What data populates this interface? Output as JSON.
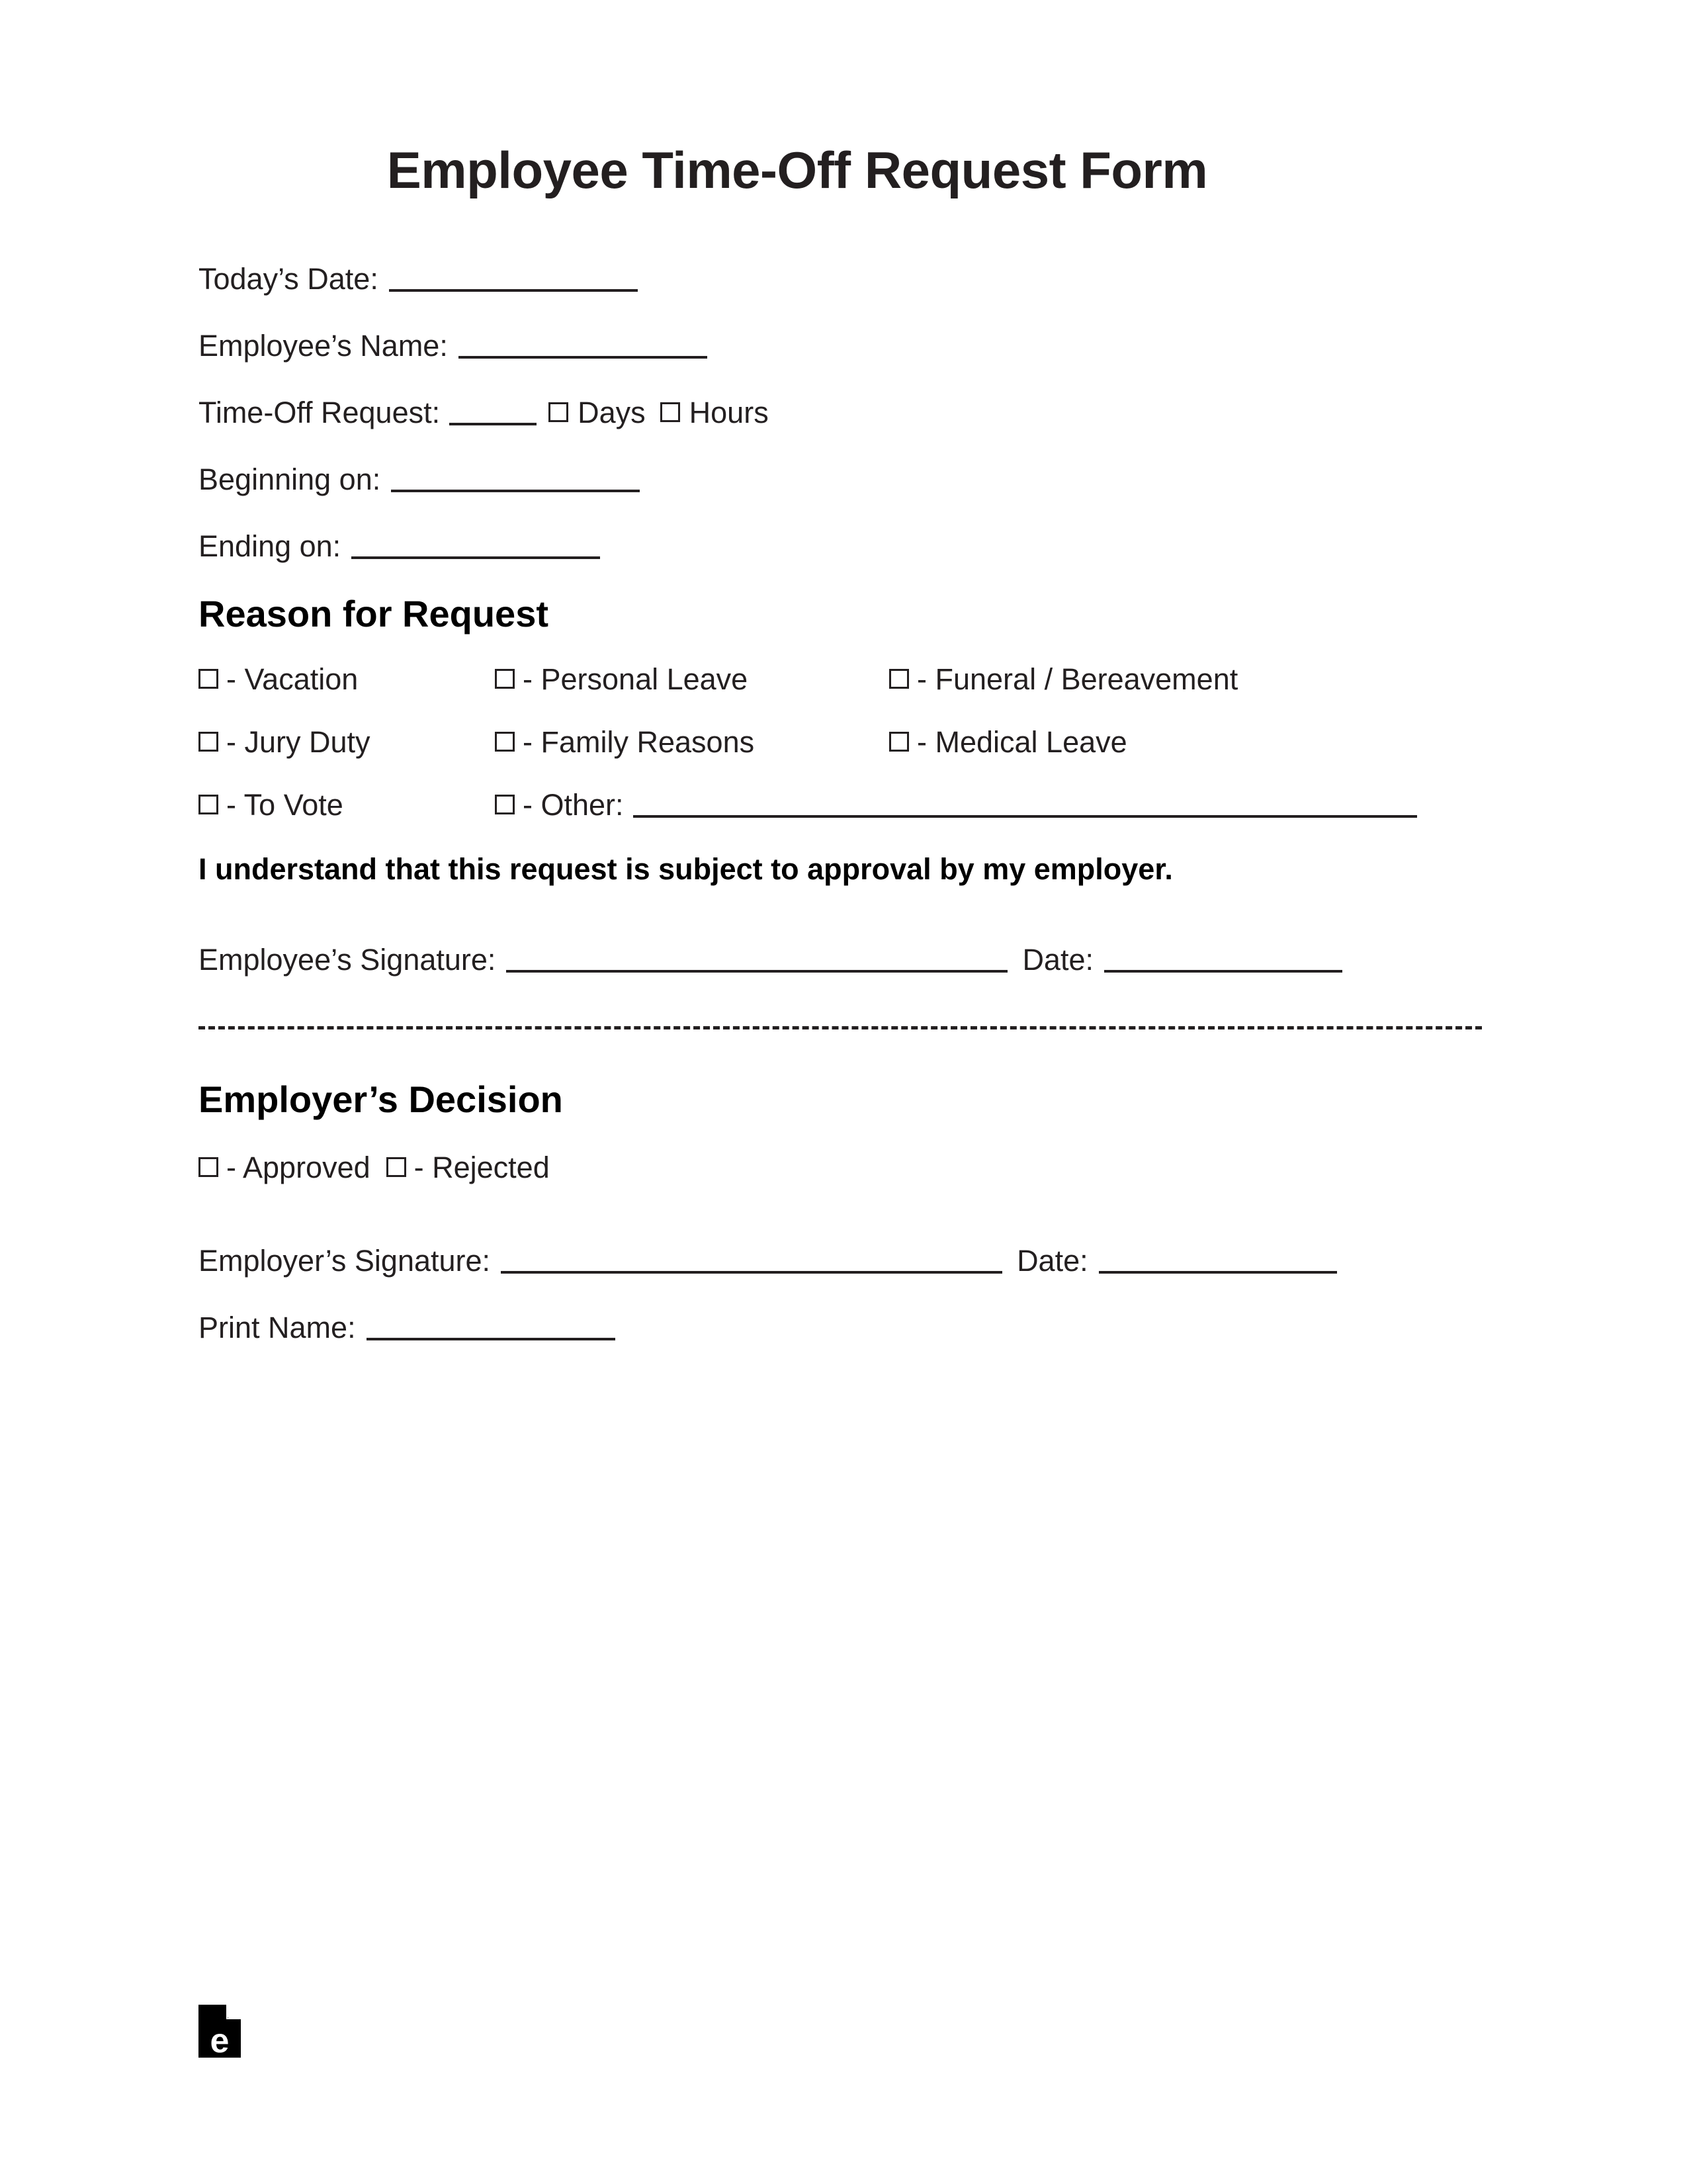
{
  "document": {
    "title": "Employee Time-Off Request Form"
  },
  "fields": {
    "todays_date_label": "Today’s Date:",
    "employee_name_label": "Employee’s Name:",
    "time_off_request_label": "Time-Off Request:",
    "days_label": "Days",
    "hours_label": "Hours",
    "beginning_on_label": "Beginning on:",
    "ending_on_label": "Ending on:"
  },
  "reason_section": {
    "heading": "Reason for Request",
    "options": [
      {
        "label": "- Vacation"
      },
      {
        "label": "- Personal Leave"
      },
      {
        "label": "- Funeral / Bereavement"
      },
      {
        "label": "- Jury Duty"
      },
      {
        "label": "- Family Reasons"
      },
      {
        "label": "- Medical Leave"
      },
      {
        "label": "- To Vote"
      },
      {
        "label": "- Other:"
      }
    ]
  },
  "acknowledgement": {
    "statement": "I understand that this request is subject to approval by my employer."
  },
  "employee_signature": {
    "signature_label": "Employee’s Signature:",
    "date_label": "Date:"
  },
  "employer_section": {
    "heading": "Employer’s Decision",
    "approved_label": "- Approved",
    "rejected_label": "- Rejected",
    "signature_label": "Employer’s Signature:",
    "date_label": "Date:",
    "print_name_label": "Print Name:"
  },
  "footer": {
    "logo_letter": "e"
  },
  "colors": {
    "text": "#231f20",
    "heading": "#000000",
    "rule": "#231f20",
    "page_background": "#ffffff"
  }
}
